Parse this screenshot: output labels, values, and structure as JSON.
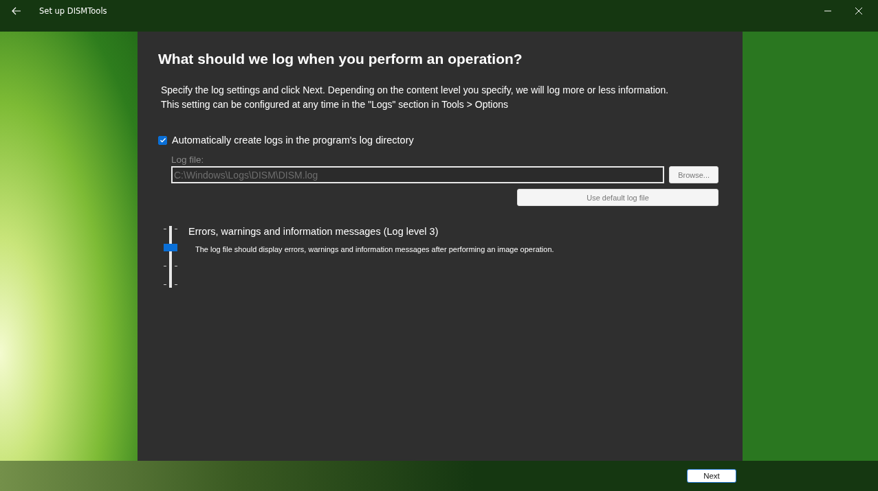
{
  "window": {
    "title": "Set up DISMTools"
  },
  "page": {
    "heading": "What should we log when you perform an operation?",
    "description": "Specify the log settings and click Next. Depending on the content level you specify, we will log more or less information.\nThis setting can be configured at any time in the \"Logs\" section in Tools > Options"
  },
  "auto_logs": {
    "label": "Automatically create logs in the program's log directory",
    "checked": true
  },
  "log_file": {
    "label": "Log file:",
    "value": "C:\\Windows\\Logs\\DISM\\DISM.log",
    "disabled": true
  },
  "buttons": {
    "browse": "Browse...",
    "default": "Use default log file",
    "next": "Next"
  },
  "log_level": {
    "level": 0.667,
    "title": "Errors, warnings and information messages (Log level 3)",
    "description": "The log file should display errors, warnings and information messages after performing an image operation."
  }
}
